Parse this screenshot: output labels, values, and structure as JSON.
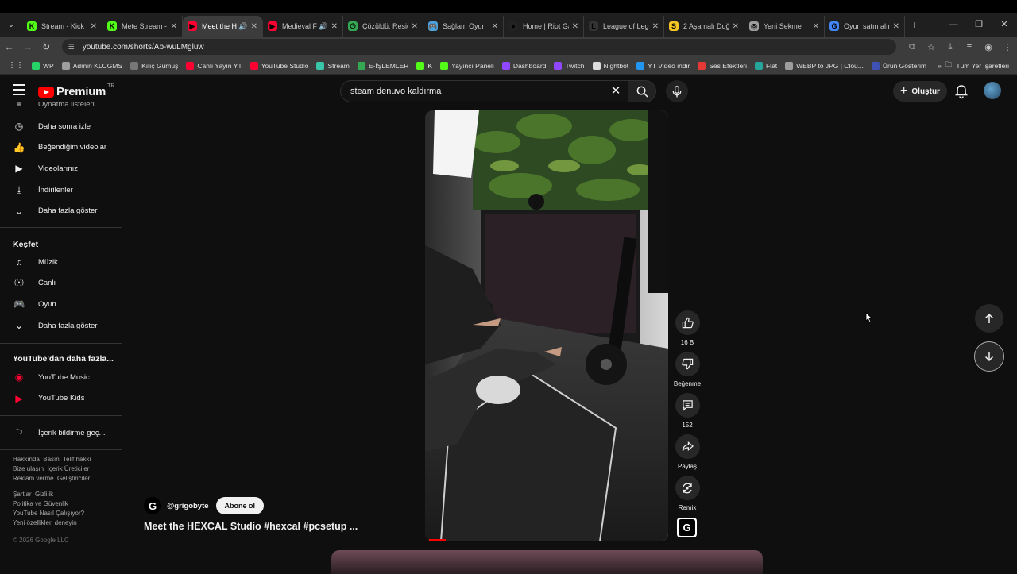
{
  "browser": {
    "tabs": [
      {
        "label": "Stream - Kick D",
        "icon": "kick-icon",
        "color": "#53fc18",
        "glyph": "K"
      },
      {
        "label": "Mete Stream -",
        "icon": "kick-icon",
        "color": "#53fc18",
        "glyph": "K"
      },
      {
        "label": "Meet the H",
        "icon": "youtube-icon",
        "color": "#ff0033",
        "glyph": "▶",
        "active": true,
        "audio": true
      },
      {
        "label": "Medieval F",
        "icon": "youtube-music-icon",
        "color": "#ff0033",
        "glyph": "▶",
        "audio": true
      },
      {
        "label": "Çözüldü: Resid",
        "icon": "power-icon",
        "color": "#34a853",
        "glyph": "⏻"
      },
      {
        "label": "Sağlam Oyun",
        "icon": "game-icon",
        "color": "#4aa3df",
        "glyph": "🎮"
      },
      {
        "label": "Home | Riot Ga",
        "icon": "riot-icon",
        "color": "#222222",
        "glyph": "●"
      },
      {
        "label": "League of Lege",
        "icon": "lol-icon",
        "color": "#333333",
        "glyph": "L"
      },
      {
        "label": "2 Aşamalı Doğ",
        "icon": "s-icon",
        "color": "#f3c623",
        "glyph": "S"
      },
      {
        "label": "Yeni Sekme",
        "icon": "chrome-icon",
        "color": "#9e9e9e",
        "glyph": "◎"
      },
      {
        "label": "Oyun satın alın",
        "icon": "google-icon",
        "color": "#4285f4",
        "glyph": "G"
      }
    ],
    "url": "youtube.com/shorts/Ab-wuLMgluw",
    "bookmarks": [
      {
        "label": "WP",
        "icon": "whatsapp-icon",
        "color": "#25d366"
      },
      {
        "label": "Admin KLCGMS",
        "icon": "globe-icon",
        "color": "#9e9e9e"
      },
      {
        "label": "Kılıç Gümüş",
        "icon": "page-icon",
        "color": "#777777"
      },
      {
        "label": "Canlı Yayın YT",
        "icon": "youtube-icon",
        "color": "#ff0033"
      },
      {
        "label": "YouTube Studio",
        "icon": "youtube-studio-icon",
        "color": "#ff0033"
      },
      {
        "label": "Stream",
        "icon": "stream-icon",
        "color": "#3ac6a8"
      },
      {
        "label": "E-İŞLEMLER",
        "icon": "grid-icon",
        "color": "#34a853"
      },
      {
        "label": "K",
        "icon": "kick-icon",
        "color": "#53fc18"
      },
      {
        "label": "Yayıncı Paneli",
        "icon": "kick-icon",
        "color": "#53fc18"
      },
      {
        "label": "Dashboard",
        "icon": "twitch-icon",
        "color": "#9146ff"
      },
      {
        "label": "Twitch",
        "icon": "twitch-icon",
        "color": "#9146ff"
      },
      {
        "label": "Nightbot",
        "icon": "nightbot-icon",
        "color": "#dddddd"
      },
      {
        "label": "YT Video indir",
        "icon": "download-icon",
        "color": "#2196f3"
      },
      {
        "label": "Ses Efektleri",
        "icon": "sound-icon",
        "color": "#e53935"
      },
      {
        "label": "Flat",
        "icon": "flat-icon",
        "color": "#26a69a"
      },
      {
        "label": "WEBP to JPG | Clou...",
        "icon": "cloud-icon",
        "color": "#9e9e9e"
      },
      {
        "label": "Ürün Gösterim",
        "icon": "product-icon",
        "color": "#3f51b5"
      }
    ],
    "all_bookmarks": "Tüm Yer İşaretleri"
  },
  "youtube": {
    "brand": "Premium",
    "region": "TR",
    "search_value": "steam denuvo kaldırma",
    "create_label": "Oluştur",
    "sidebar": {
      "partial_top": "Oynatma listeleri",
      "you_items": [
        {
          "label": "Daha sonra izle",
          "icon": "clock-icon"
        },
        {
          "label": "Beğendiğim videolar",
          "icon": "thumbs-up-icon"
        },
        {
          "label": "Videolarınız",
          "icon": "video-icon"
        },
        {
          "label": "İndirilenler",
          "icon": "download-icon"
        },
        {
          "label": "Daha fazla göster",
          "icon": "chevron-down-icon"
        }
      ],
      "explore_title": "Keşfet",
      "explore_items": [
        {
          "label": "Müzik",
          "icon": "music-icon"
        },
        {
          "label": "Canlı",
          "icon": "live-icon"
        },
        {
          "label": "Oyun",
          "icon": "gaming-icon"
        },
        {
          "label": "Daha fazla göster",
          "icon": "chevron-down-icon"
        }
      ],
      "more_title": "YouTube'dan daha fazla...",
      "more_items": [
        {
          "label": "YouTube Music",
          "icon": "youtube-music-icon"
        },
        {
          "label": "YouTube Kids",
          "icon": "youtube-kids-icon"
        }
      ],
      "report_label": "İçerik bildirme geç...",
      "footer1": [
        "Hakkında  Basın  Telif hakkı",
        "Bize ulaşın  İçerik Üreticiler",
        "Reklam verme  Geliştiriciler"
      ],
      "footer2": [
        "Şartlar  Gizlilik",
        "Politika ve Güvenlik",
        "YouTube Nasıl Çalışıyor?",
        "Yeni özellikleri deneyin"
      ],
      "copyright": "© 2026 Google LLC"
    },
    "short": {
      "channel": "@grigobyte",
      "subscribe": "Abone ol",
      "title": "Meet the HEXCAL Studio #hexcal #pcsetup ...",
      "likes": "16 B",
      "dislike_label": "Beğenme",
      "comments": "152",
      "share_label": "Paylaş",
      "remix_label": "Remix",
      "progress": 0.07
    }
  }
}
